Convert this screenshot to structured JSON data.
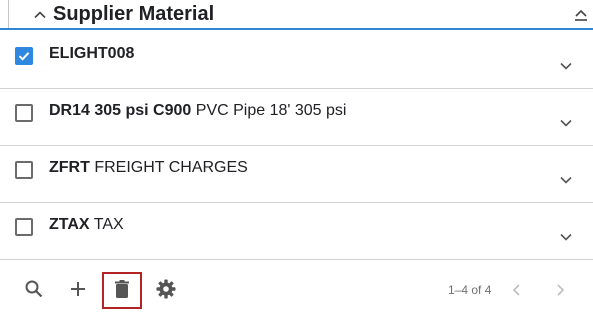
{
  "header": {
    "title": "Supplier Material",
    "collapse_icon": "chevron-up-icon",
    "action_icon": "collapse-section-icon"
  },
  "items": [
    {
      "code": "ELIGHT008",
      "description": "",
      "checked": true
    },
    {
      "code": "DR14 305 psi C900",
      "description": "PVC Pipe 18' 305 psi",
      "checked": false
    },
    {
      "code": "ZFRT",
      "description": "FREIGHT CHARGES",
      "checked": false
    },
    {
      "code": "ZTAX",
      "description": "TAX",
      "checked": false
    }
  ],
  "footer": {
    "tools": [
      "search-icon",
      "add-icon",
      "delete-icon",
      "settings-icon"
    ],
    "pager_text": "1–4 of 4"
  },
  "colors": {
    "accent": "#2f86d6",
    "checkbox_checked": "#2e88e0",
    "highlight_border": "#b32424"
  }
}
